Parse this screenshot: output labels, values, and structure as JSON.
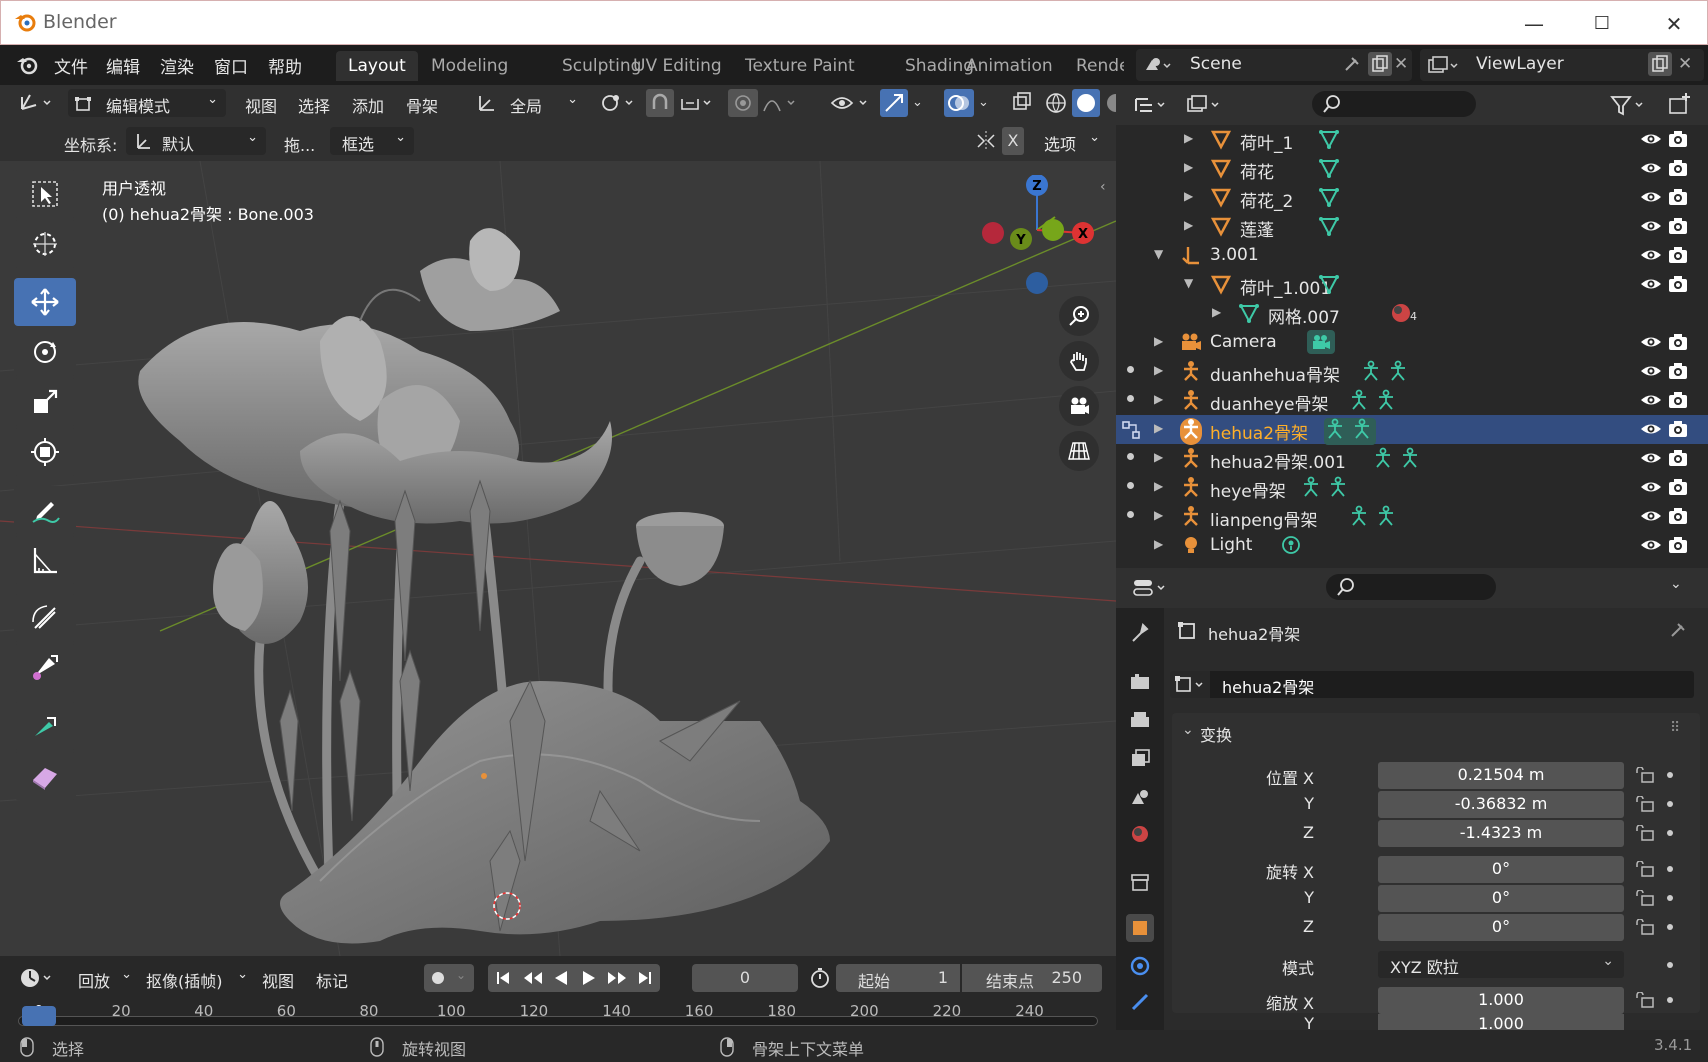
{
  "window": {
    "title": "Blender",
    "minimize_icon": "—",
    "maximize_icon": "☐",
    "close_icon": "✕"
  },
  "menu": {
    "items": [
      "文件",
      "编辑",
      "渲染",
      "窗口",
      "帮助"
    ]
  },
  "workspaces": {
    "tabs": [
      "Layout",
      "Modeling",
      "Sculpting",
      "UV Editing",
      "Texture Paint",
      "Shading",
      "Animation",
      "Rende"
    ],
    "active": "Layout"
  },
  "scene": {
    "name": "Scene",
    "view_layer": "ViewLayer"
  },
  "viewport_header": {
    "mode": "编辑模式",
    "menus": [
      "视图",
      "选择",
      "添加",
      "骨架"
    ],
    "pivot": "全局",
    "coord_label": "坐标系:",
    "coord_value": "默认",
    "drag_label": "拖...",
    "select_mode": "框选",
    "x_label": "X",
    "options_label": "选项"
  },
  "viewport": {
    "view_name": "用户透视",
    "active_info": "(0) hehua2骨架 : Bone.003",
    "gizmo": {
      "z": "Z",
      "y": "Y",
      "x": "X"
    }
  },
  "outliner": {
    "rows": [
      {
        "name": "荷叶_1",
        "type": "mesh",
        "indent": 2
      },
      {
        "name": "荷花",
        "type": "mesh",
        "indent": 2
      },
      {
        "name": "荷花_2",
        "type": "mesh",
        "indent": 2
      },
      {
        "name": "莲蓬",
        "type": "mesh",
        "indent": 2
      },
      {
        "name": "3.001",
        "type": "empty",
        "indent": 1,
        "expanded": true
      },
      {
        "name": "荷叶_1.001",
        "type": "mesh",
        "indent": 2,
        "expanded": true
      },
      {
        "name": "网格.007",
        "type": "meshdata",
        "indent": 3,
        "badge": "4"
      },
      {
        "name": "Camera",
        "type": "camera",
        "indent": 1
      },
      {
        "name": "duanhehua骨架",
        "type": "armature",
        "indent": 1,
        "dot": true
      },
      {
        "name": "duanheye骨架",
        "type": "armature",
        "indent": 1,
        "dot": true
      },
      {
        "name": "hehua2骨架",
        "type": "armature",
        "indent": 1,
        "selected": true
      },
      {
        "name": "hehua2骨架.001",
        "type": "armature",
        "indent": 1,
        "dot": true
      },
      {
        "name": "heye骨架",
        "type": "armature",
        "indent": 1,
        "dot": true
      },
      {
        "name": "lianpeng骨架",
        "type": "armature",
        "indent": 1,
        "dot": true
      },
      {
        "name": "Light",
        "type": "light",
        "indent": 1
      }
    ]
  },
  "properties": {
    "object_title": "hehua2骨架",
    "object_name": "hehua2骨架",
    "section": "变换",
    "location": {
      "label": "位置 X",
      "x": "0.21504 m",
      "y": "-0.36832 m",
      "z": "-1.4323 m"
    },
    "rotation": {
      "label": "旋转 X",
      "x": "0°",
      "y": "0°",
      "z": "0°"
    },
    "mode_label": "模式",
    "mode_value": "XYZ 欧拉",
    "scale": {
      "label": "缩放 X",
      "x": "1.000",
      "y": "1.000"
    },
    "axis_y": "Y",
    "axis_z": "Z"
  },
  "timeline": {
    "playback": "回放",
    "keying": "抠像(插帧)",
    "view": "视图",
    "marker": "标记",
    "current_frame": "0",
    "start_label": "起始",
    "start": "1",
    "end_label": "结束点",
    "end": "250",
    "ticks": [
      "0",
      "20",
      "40",
      "60",
      "80",
      "100",
      "120",
      "140",
      "160",
      "180",
      "200",
      "220",
      "240"
    ]
  },
  "statusbar": {
    "select": "选择",
    "rotate": "旋转视图",
    "context": "骨架上下文菜单",
    "version": "3.4.1"
  },
  "colors": {
    "accent": "#4772b3",
    "selected_row": "#334d80",
    "highlight_text": "#ffaf29",
    "mesh_icon": "#e8913a",
    "armature_green": "#3ec9a7"
  }
}
